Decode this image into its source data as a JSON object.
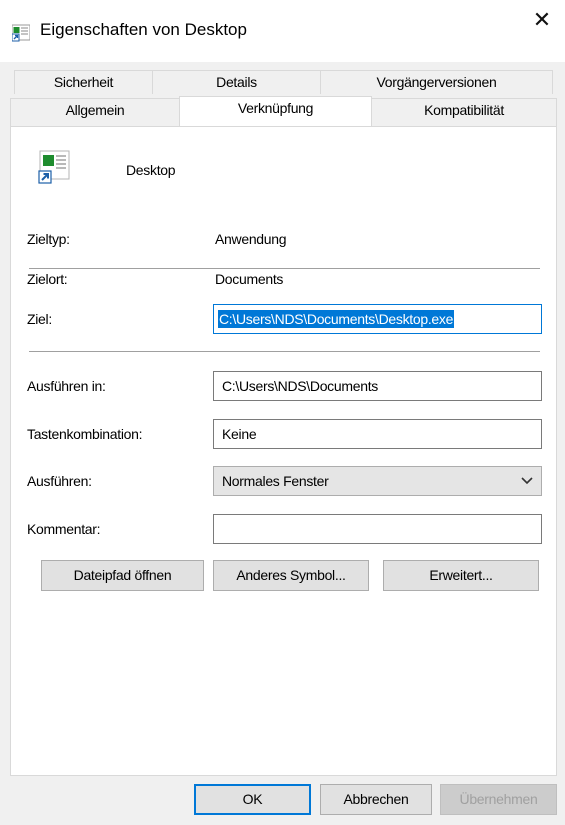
{
  "window": {
    "title": "Eigenschaften von Desktop",
    "close_glyph": "✕"
  },
  "tabs": {
    "row1": [
      "Sicherheit",
      "Details",
      "Vorgängerversionen"
    ],
    "row2": [
      "Allgemein",
      "Verknüpfung",
      "Kompatibilität"
    ],
    "active": "Verknüpfung"
  },
  "shortcut": {
    "name": "Desktop",
    "target_type_label": "Zieltyp:",
    "target_type_value": "Anwendung",
    "target_location_label": "Zielort:",
    "target_location_value": "Documents",
    "target_label": "Ziel:",
    "target_value": "C:\\Users\\NDS\\Documents\\Desktop.exe",
    "start_in_label": "Ausführen in:",
    "start_in_value": "C:\\Users\\NDS\\Documents",
    "hotkey_label": "Tastenkombination:",
    "hotkey_value": "Keine",
    "run_label": "Ausführen:",
    "run_value": "Normales Fenster",
    "comment_label": "Kommentar:",
    "comment_value": ""
  },
  "buttons": {
    "open_location": "Dateipfad öffnen",
    "change_icon": "Anderes Symbol...",
    "advanced": "Erweitert...",
    "ok": "OK",
    "cancel": "Abbrechen",
    "apply": "Übernehmen"
  },
  "icons": {
    "title": "shortcut-app-icon",
    "shortcut": "shortcut-app-icon",
    "dropdown": "chevron-down-icon",
    "close": "close-icon"
  },
  "colors": {
    "accent": "#0078d7",
    "icon_green": "#1e8c2e",
    "client_bg": "#f0f0f0",
    "panel_bg": "#ffffff"
  }
}
